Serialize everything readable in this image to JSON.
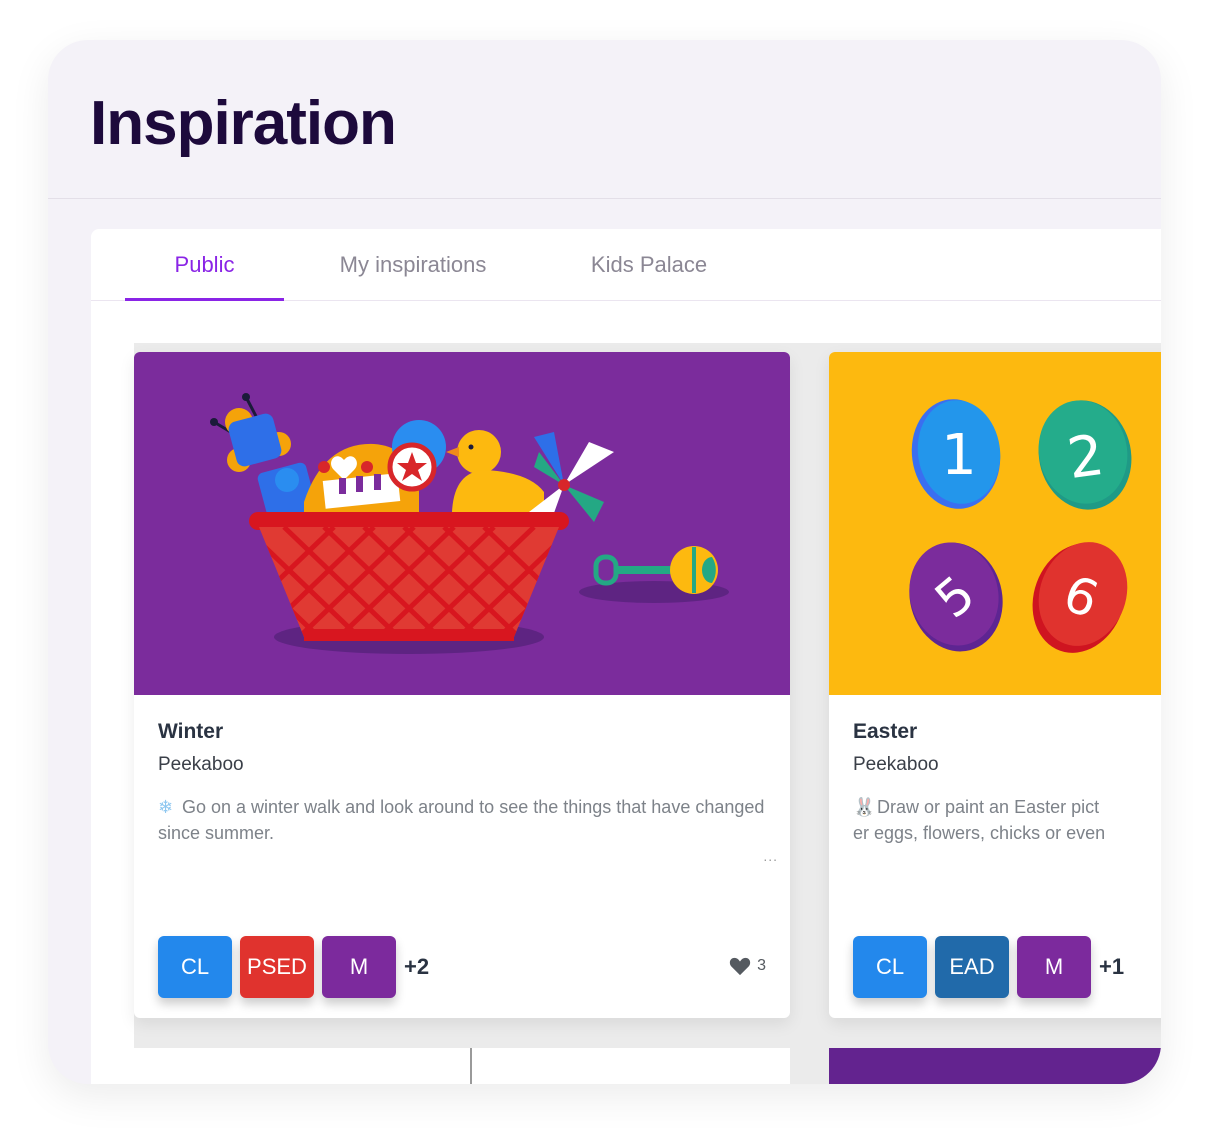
{
  "header": {
    "title": "Inspiration"
  },
  "tabs": [
    {
      "label": "Public",
      "active": true
    },
    {
      "label": "My inspirations",
      "active": false
    },
    {
      "label": "Kids Palace",
      "active": false
    }
  ],
  "cards": [
    {
      "title": "Winter",
      "author": "Peekaboo",
      "emoji": "snowflake-icon",
      "emoji_glyph": "❄",
      "description": "Go on a winter walk and look around to see the things that have changed since summer.",
      "more_label": "...",
      "image": "toy-basket-illustration",
      "image_bg": "#7b2c9c",
      "badges": [
        {
          "label": "CL",
          "color": "#2388ec"
        },
        {
          "label": "PSED",
          "color": "#e0332e"
        },
        {
          "label": "M",
          "color": "#7c2a9d"
        }
      ],
      "extra_badges": "+2",
      "likes": "3"
    },
    {
      "title": "Easter",
      "author": "Peekaboo",
      "emoji": "rabbit-icon",
      "emoji_glyph": "🐰",
      "description_line1": "Draw or paint an Easter pict",
      "description_line2": "er eggs, flowers, chicks or even",
      "image": "numbered-eggs-illustration",
      "image_bg": "#fdb90f",
      "egg_numbers": [
        "1",
        "2",
        "5",
        "6"
      ],
      "badges": [
        {
          "label": "CL",
          "color": "#2388ec"
        },
        {
          "label": "EAD",
          "color": "#216aaa"
        },
        {
          "label": "M",
          "color": "#7c2a9d"
        }
      ],
      "extra_badges": "+1"
    }
  ],
  "colors": {
    "accent": "#8a24e6",
    "title": "#1d0a3c",
    "page_bg": "#f4f2f8"
  }
}
